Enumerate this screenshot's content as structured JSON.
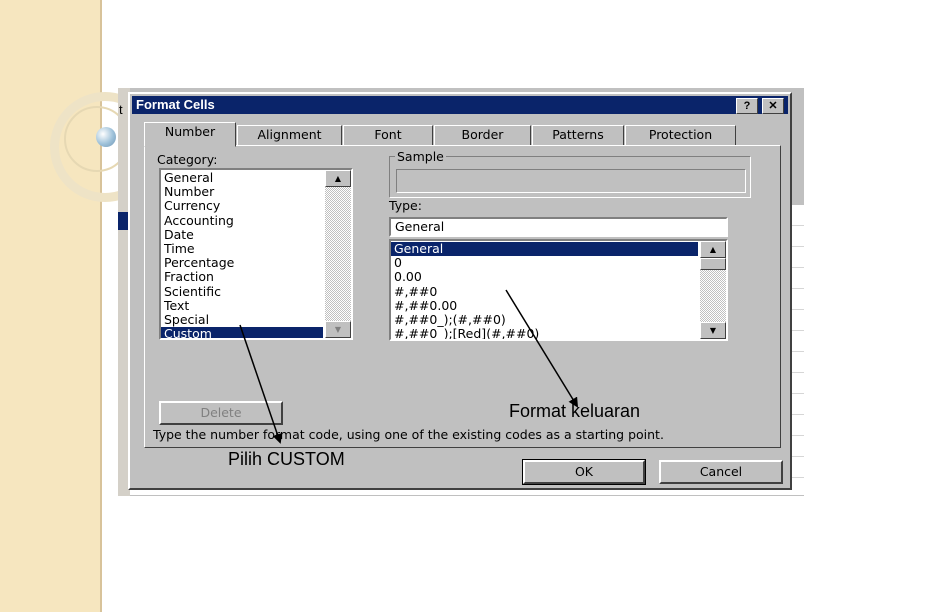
{
  "excel_background": {
    "cut_text": "t"
  },
  "dialog": {
    "title": "Format Cells",
    "help_button": "?",
    "close_button": "✕",
    "tabs": [
      {
        "label": "Number",
        "active": true
      },
      {
        "label": "Alignment"
      },
      {
        "label": "Font"
      },
      {
        "label": "Border"
      },
      {
        "label": "Patterns"
      },
      {
        "label": "Protection"
      }
    ],
    "category_label": "Category:",
    "categories": [
      "General",
      "Number",
      "Currency",
      "Accounting",
      "Date",
      "Time",
      "Percentage",
      "Fraction",
      "Scientific",
      "Text",
      "Special",
      "Custom"
    ],
    "selected_category": "Custom",
    "sample_label": "Sample",
    "type_label": "Type:",
    "type_value": "General",
    "type_list": [
      "General",
      "0",
      "0.00",
      "#,##0",
      "#,##0.00",
      "#,##0_);(#,##0)",
      "#,##0_);[Red](#,##0)"
    ],
    "selected_type": "General",
    "delete_button": "Delete",
    "description": "Type the number format code, using one of the existing codes as a starting point.",
    "ok_button": "OK",
    "cancel_button": "Cancel"
  },
  "annotations": {
    "pilih_custom": "Pilih CUSTOM",
    "format_keluaran": "Format keluaran"
  },
  "colors": {
    "title_bar": "#0a246a",
    "dialog_face": "#c0c0c0",
    "slide_band": "#f6e6bf"
  }
}
